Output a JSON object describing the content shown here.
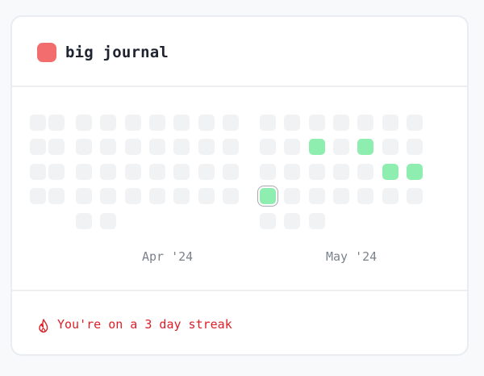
{
  "journal": {
    "title": "big journal",
    "color": "#f26d6d"
  },
  "calendar": {
    "empty_color": "#f1f2f4",
    "active_color": "#8eeeaf",
    "months": [
      {
        "label": "Apr '24"
      },
      {
        "label": "May '24"
      }
    ],
    "weeks": [
      [
        0,
        0,
        0,
        0,
        null
      ],
      [
        0,
        0,
        0,
        0,
        null
      ],
      [
        0,
        0,
        0,
        0,
        0
      ],
      [
        0,
        0,
        0,
        0,
        0
      ],
      [
        0,
        0,
        0,
        0,
        null
      ],
      [
        0,
        0,
        0,
        0,
        null
      ],
      [
        0,
        0,
        0,
        0,
        null
      ],
      [
        0,
        0,
        0,
        0,
        null
      ],
      [
        0,
        0,
        0,
        0,
        null
      ],
      [
        0,
        0,
        0,
        1,
        0
      ],
      [
        0,
        0,
        0,
        0,
        0
      ],
      [
        0,
        1,
        0,
        0,
        0
      ],
      [
        0,
        0,
        0,
        0,
        null
      ],
      [
        0,
        1,
        0,
        0,
        null
      ],
      [
        0,
        0,
        1,
        0,
        null
      ],
      [
        0,
        0,
        1,
        0,
        null
      ]
    ],
    "today": {
      "week": 9,
      "day": 3
    }
  },
  "footer": {
    "streak_text": "You're on a 3 day streak",
    "icon": "flame-icon",
    "streak_color": "#dc1f26"
  }
}
